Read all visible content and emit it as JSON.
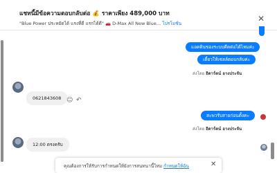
{
  "header": {
    "title": "แชทนี้มีข้อความตอบกลับต่อ 💰 ราคาเพียง 489,000 บาท",
    "subtitle": "\"Blue Power ประหยัดได้ แรงที่ดี แรกได้ดี\" 🚗 D-Max All New Blue…",
    "subtitle_link": "โปรโมชั่น"
  },
  "messages": {
    "out1": "แอดดินของระบบดีดต่อได้ไหมค่ะ",
    "out2": "เดี๋ยวให้เซลล์ตอบกลับค่ะ",
    "sent_by_prefix": "ส่งโดย",
    "sent_by_name": "อิดาร์ตน์ อางประจัน",
    "in1": "0621843608",
    "out3": "สะพวรับสายก่อนตั้งคะ",
    "in2": "12:00 ตรงครับ"
  },
  "toast": {
    "text": "คุณต้องการให้รับการกำหนดให้ยังการสนทนานี้ไหม",
    "link": "กำหนดให้ฉัน"
  },
  "icons": {
    "close": "close-icon",
    "emoji": "emoji-icon",
    "reply": "reply-icon"
  }
}
